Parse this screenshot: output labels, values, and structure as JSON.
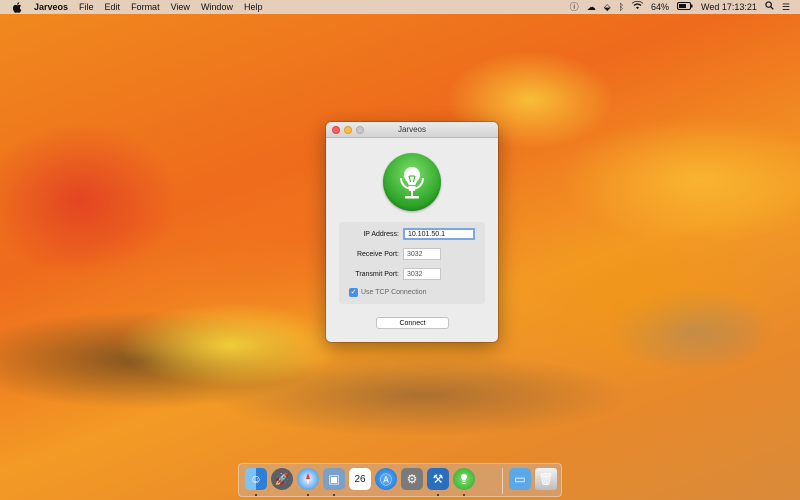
{
  "menubar": {
    "apple_icon": "apple-icon",
    "app_name": "Jarveos",
    "items": [
      "File",
      "Edit",
      "Format",
      "View",
      "Window",
      "Help"
    ],
    "status": {
      "battery": "64%",
      "datetime": "Wed 17:13:21"
    }
  },
  "window": {
    "title": "Jarveos",
    "form": {
      "ip_label": "IP Address:",
      "ip_value": "10.101.50.1",
      "receive_label": "Receive Port:",
      "receive_value": "3032",
      "transmit_label": "Transmit Port:",
      "transmit_value": "3032",
      "tcp_label": "Use TCP Connection",
      "tcp_checked": true
    },
    "connect_label": "Connect"
  },
  "dock": {
    "items": [
      {
        "name": "finder",
        "color": "#3a8fe0"
      },
      {
        "name": "launchpad",
        "color": "#5b5f66"
      },
      {
        "name": "safari",
        "color": "#1e88e5"
      },
      {
        "name": "preview",
        "color": "#7aa0c8"
      },
      {
        "name": "calendar",
        "color": "#ffffff",
        "label": "26"
      },
      {
        "name": "app-store",
        "color": "#1e7de0"
      },
      {
        "name": "system-preferences",
        "color": "#7a7a7a"
      },
      {
        "name": "xcode",
        "color": "#2a6fbe"
      },
      {
        "name": "jarveos",
        "color": "#2fa52a"
      },
      {
        "name": "downloads-folder",
        "color": "#5aa8e8"
      },
      {
        "name": "trash",
        "color": "#d9d9d9"
      }
    ]
  },
  "colors": {
    "accent": "#4a90e2",
    "logo_green": "#2fa52a"
  }
}
